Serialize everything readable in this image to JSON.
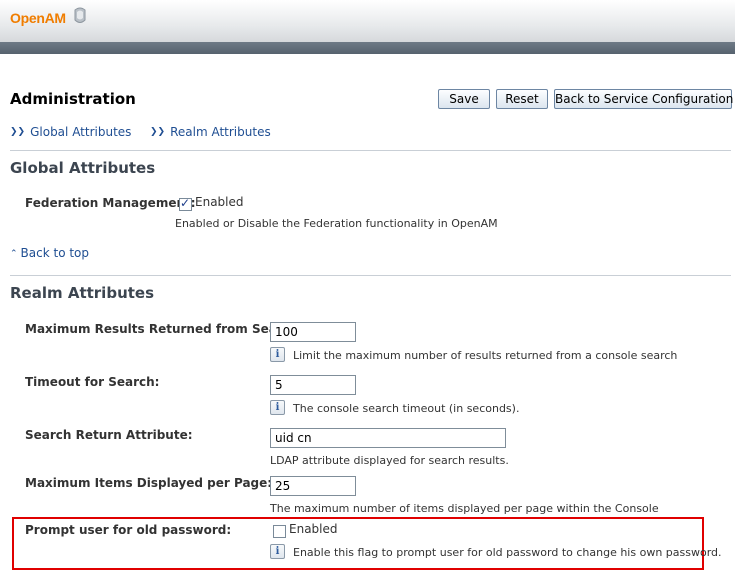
{
  "masthead": {
    "logo_text": "OpenAM"
  },
  "header": {
    "title": "Administration"
  },
  "toolbar": {
    "save_label": "Save",
    "reset_label": "Reset",
    "back_label": "Back to Service Configuration"
  },
  "jump_links": {
    "global": "Global Attributes",
    "realm": "Realm Attributes"
  },
  "global_section": {
    "title": "Global Attributes",
    "federation": {
      "label": "Federation Management:",
      "checkbox_label": "Enabled",
      "checked": true,
      "help": "Enabled or Disable the Federation functionality in OpenAM"
    }
  },
  "back_to_top": "Back to top",
  "realm_section": {
    "title": "Realm Attributes",
    "max_results": {
      "label": "Maximum Results Returned from Search:",
      "value": "100",
      "help": "Limit the maximum number of results returned from a console search"
    },
    "timeout": {
      "label": "Timeout for Search:",
      "value": "5",
      "help": "The console search timeout (in seconds)."
    },
    "return_attr": {
      "label": "Search Return Attribute:",
      "value": "uid cn",
      "help": "LDAP attribute displayed for search results."
    },
    "max_items": {
      "label": "Maximum Items Displayed per Page:",
      "value": "25",
      "help": "The maximum number of items displayed per page within the Console"
    },
    "prompt_old_pw": {
      "label": "Prompt user for old password:",
      "checkbox_label": "Enabled",
      "checked": false,
      "help": "Enable this flag to prompt user for old password to change his own password."
    }
  },
  "icons": {
    "chevron": "chevron-down-icon",
    "up": "chevron-up-icon",
    "info": "info-icon",
    "check": "checkmark-icon"
  },
  "colors": {
    "brand": "#f07d00",
    "link": "#1f4e92",
    "highlight": "#e00000",
    "navbar": "#5d6975"
  }
}
